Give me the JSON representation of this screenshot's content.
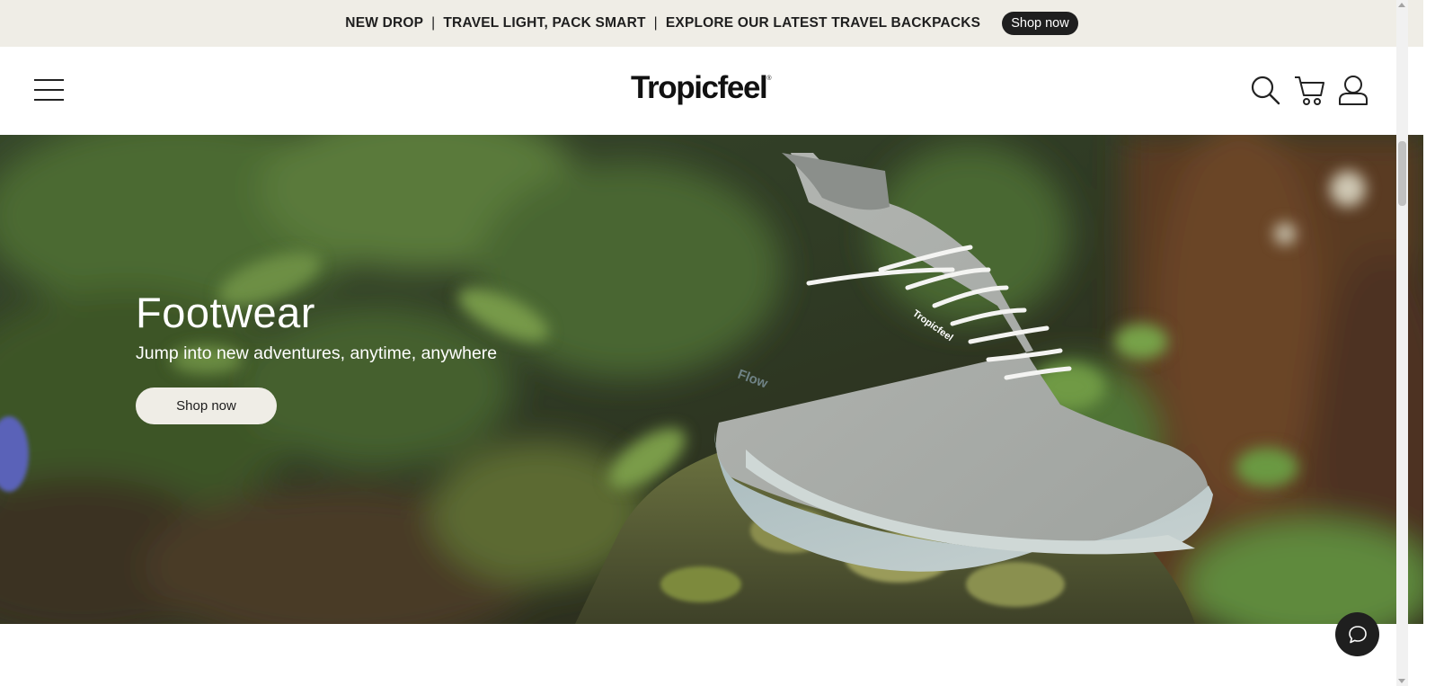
{
  "announcement": {
    "item1": "NEW DROP",
    "item2": "TRAVEL LIGHT, PACK SMART",
    "item3": "EXPLORE OUR LATEST TRAVEL BACKPACKS",
    "separator": "|",
    "cta_label": "Shop now"
  },
  "header": {
    "logo_text": "Tropicfeel",
    "logo_mark": "®",
    "icons": [
      "menu-icon",
      "search-icon",
      "cart-icon",
      "account-icon"
    ]
  },
  "hero": {
    "title": "Footwear",
    "subtitle": "Jump into new adventures, anytime, anywhere",
    "cta_label": "Shop now",
    "shoe_logo_text": "Tropicfeel",
    "shoe_sole_text": "Flow"
  },
  "chat": {
    "icon": "chat-bubble-icon"
  },
  "colors": {
    "announcement_bg": "#efede6",
    "pill_bg": "#1f1f1f",
    "hero_button_bg": "#efede6",
    "chat_bg": "#1f1f1f"
  }
}
